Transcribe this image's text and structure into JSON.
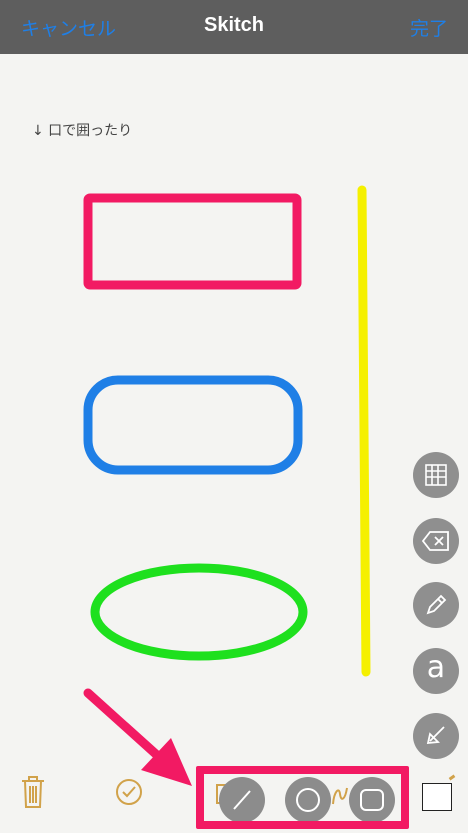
{
  "nav": {
    "cancel": "キャンセル",
    "title": "Skitch",
    "done": "完了"
  },
  "canvas": {
    "note": "↓ 口で囲ったり"
  },
  "colors": {
    "nav_bg": "#5e5e5e",
    "nav_link": "#1f7fe6",
    "pink": "#f21a63",
    "blue": "#1f7fe6",
    "green": "#1ee01e",
    "yellow": "#f5f000",
    "tool_gray": "#8f8f8f",
    "gold": "#d1a24a"
  },
  "tools": [
    {
      "name": "pixelate-icon"
    },
    {
      "name": "eraser-icon"
    },
    {
      "name": "pen-icon"
    },
    {
      "name": "text-icon"
    },
    {
      "name": "arrow-icon"
    }
  ],
  "shape_options": [
    {
      "name": "line-shape-icon"
    },
    {
      "name": "circle-shape-icon"
    },
    {
      "name": "rounded-rect-shape-icon"
    }
  ]
}
